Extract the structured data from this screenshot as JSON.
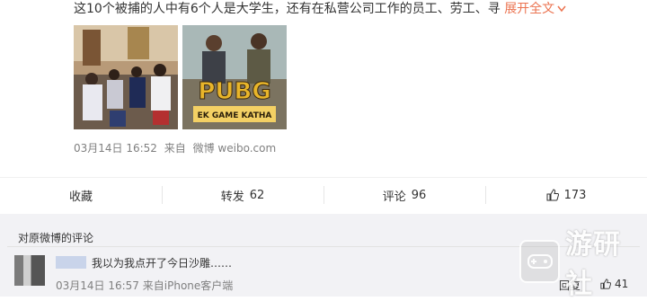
{
  "post": {
    "text": "这10个被捕的人中有6个人是大学生，还有在私营公司工作的员工、劳工、寻",
    "expand_label": "展开全文",
    "image2_title": "PUBG",
    "image2_subtitle": "EK GAME KATHA",
    "date": "03月14日 16:52",
    "source_prefix": "来自",
    "source": "微博 weibo.com"
  },
  "actions": {
    "favorite_label": "收藏",
    "repost_label": "转发",
    "repost_count": "62",
    "comment_label": "评论",
    "comment_count": "96",
    "like_count": "173"
  },
  "comments": {
    "header": "对原微博的评论",
    "items": [
      {
        "text": "我以为我点开了今日沙雕……",
        "date": "03月14日 16:57",
        "source": "来自iPhone客户端",
        "reply_label": "回复",
        "like_count": "41"
      }
    ]
  },
  "watermark": {
    "text": "游研社"
  }
}
